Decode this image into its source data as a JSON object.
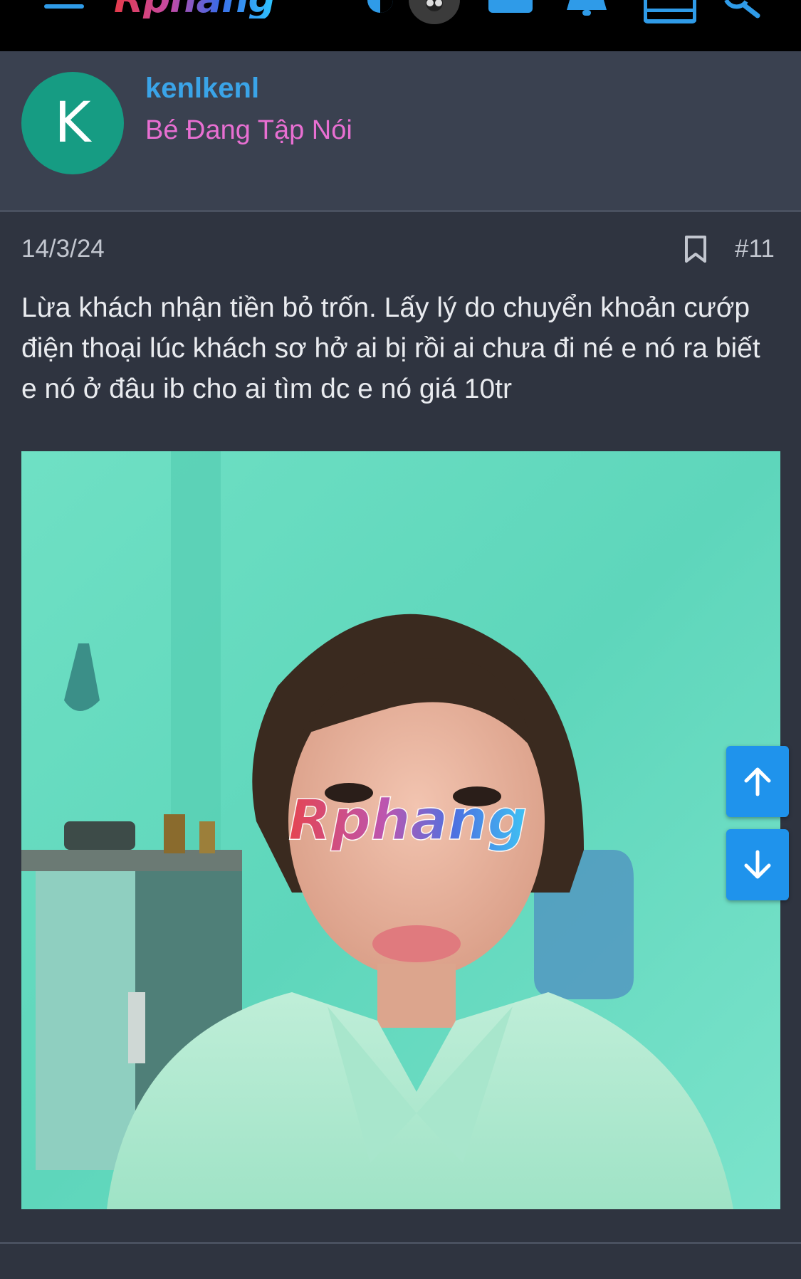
{
  "header": {
    "logo_text": "Rphang"
  },
  "user": {
    "avatar_letter": "K",
    "name": "kenlkenl",
    "title": "Bé Đang Tập Nói"
  },
  "post": {
    "date": "14/3/24",
    "number": "#11",
    "body": "Lừa khách nhận tiền bỏ trốn. Lấy lý do chuyển khoản cướp điện thoại lúc khách sơ hở ai bị rồi ai chưa đi né e nó ra biết e nó ở đâu ib cho ai tìm dc e nó giá 10tr",
    "image_watermark": "Rphang"
  },
  "colors": {
    "accent": "#1f93ec",
    "username": "#3aa4e8",
    "usertitle": "#e86fd2",
    "avatar_bg": "#169c83",
    "background": "#2f3440"
  },
  "icons": {
    "menu": "menu-icon",
    "theme": "theme-toggle-icon",
    "avatar_small": "user-avatar-icon",
    "messages": "messages-icon",
    "notifications": "bell-icon",
    "list": "list-icon",
    "search": "search-icon",
    "bookmark": "bookmark-icon",
    "scroll_up": "arrow-up-icon",
    "scroll_down": "arrow-down-icon"
  }
}
